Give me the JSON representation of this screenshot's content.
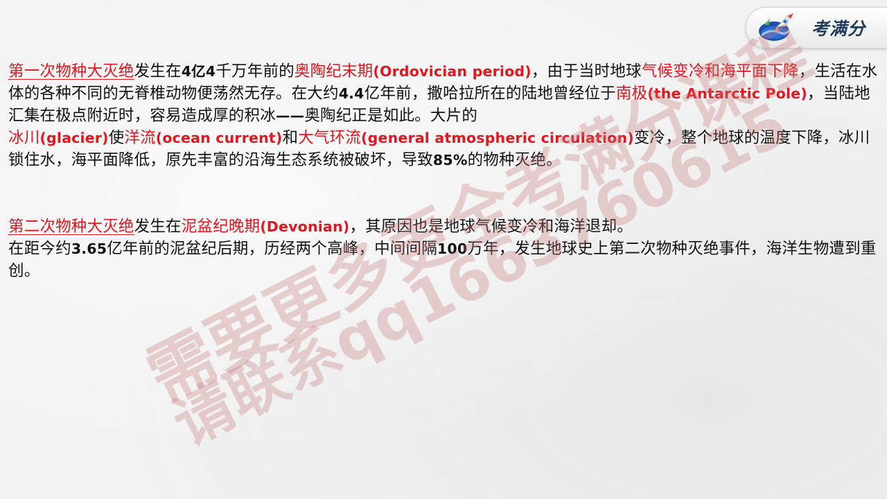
{
  "logo": {
    "text": "考满分"
  },
  "paragraph1": {
    "s1": "第一次物种大灭绝",
    "s2": "发生在",
    "s3": "4亿4",
    "s4": "千万年前的",
    "s5": "奥陶纪末期",
    "s6": "(Ordovician period)",
    "s7": "，由于当时地球",
    "s8": "气候变冷和海平面下降",
    "s9": "，生活在水体的各种不同的无脊椎动物便荡然无存。在大约",
    "s10": "4.4",
    "s11": "亿年前，撒哈拉所在的陆地曾经位于",
    "s12": "南极",
    "s13": "(the Antarctic Pole)",
    "s14": "，当陆地汇集在极点附近时，容易造成厚的积冰",
    "s15": "——",
    "s16": "奥陶纪正是如此。大片的",
    "s17": "冰川",
    "s18": "(glacier)",
    "s19": "使",
    "s20": "洋流",
    "s21": "(ocean current)",
    "s22": "和",
    "s23": "大气环流",
    "s24": "(general atmospheric circulation)",
    "s25": "变冷，整个地球的温度下降，冰川锁住水，海平面降低，原先丰富的沿海生态系统被破坏，导致",
    "s26": "85%",
    "s27": "的物种灭绝。"
  },
  "paragraph2": {
    "s1": "第二次物种大灭绝",
    "s2": "发生在",
    "s3": "泥盆纪晚期",
    "s4": "(Devonian)",
    "s5": "，其原因也是地球气候变冷和海洋退却。",
    "s6": "在距今约",
    "s7": "3.65",
    "s8": "亿年前的泥盆纪后期，历经两个高峰，中间间隔",
    "s9": "100",
    "s10": "万年，发生地球史上第二次物种灭绝事件，海洋生物遭到重创。"
  },
  "watermark": {
    "line1": "需要更多更全考满分课程",
    "line2": "请联系qq1663760615"
  },
  "colors": {
    "highlight": "#e8141e",
    "text": "#111111",
    "watermark": "#c47878"
  }
}
